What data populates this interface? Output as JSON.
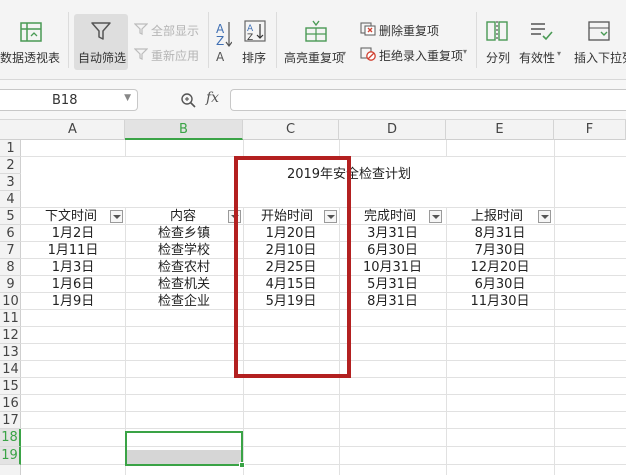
{
  "ribbon": {
    "pivot_label": "数据透视表",
    "autofilter_label": "自动筛选",
    "show_all_label": "全部显示",
    "reapply_label": "重新应用",
    "sort_label": "排序",
    "highlight_dup_label": "高亮重复项",
    "delete_dup_label": "删除重复项",
    "reject_dup_label": "拒绝录入重复项",
    "split_label": "分列",
    "validity_label": "有效性",
    "insert_dropdown_label": "插入下拉列"
  },
  "formula_bar": {
    "name_box": "B18",
    "fx_label": "fx",
    "formula": ""
  },
  "columns": [
    "A",
    "B",
    "C",
    "D",
    "E",
    "F"
  ],
  "rows": [
    "1",
    "2",
    "3",
    "4",
    "5",
    "6",
    "7",
    "8",
    "9",
    "10",
    "11",
    "12",
    "13",
    "14",
    "15",
    "16",
    "17",
    "18",
    "19"
  ],
  "sheet": {
    "title": "2019年安全检查计划",
    "headers": [
      "下文时间",
      "内容",
      "开始时间",
      "完成时间",
      "上报时间"
    ],
    "data": [
      [
        "1月2日",
        "检查乡镇",
        "1月20日",
        "3月31日",
        "8月31日"
      ],
      [
        "1月11日",
        "检查学校",
        "2月10日",
        "6月30日",
        "7月30日"
      ],
      [
        "1月3日",
        "检查农村",
        "2月25日",
        "10月31日",
        "12月20日"
      ],
      [
        "1月6日",
        "检查机关",
        "4月15日",
        "5月31日",
        "6月30日"
      ],
      [
        "1月9日",
        "检查企业",
        "5月19日",
        "8月31日",
        "11月30日"
      ]
    ]
  },
  "colors": {
    "accent": "#3aa346",
    "highlight_box": "#b32020"
  }
}
